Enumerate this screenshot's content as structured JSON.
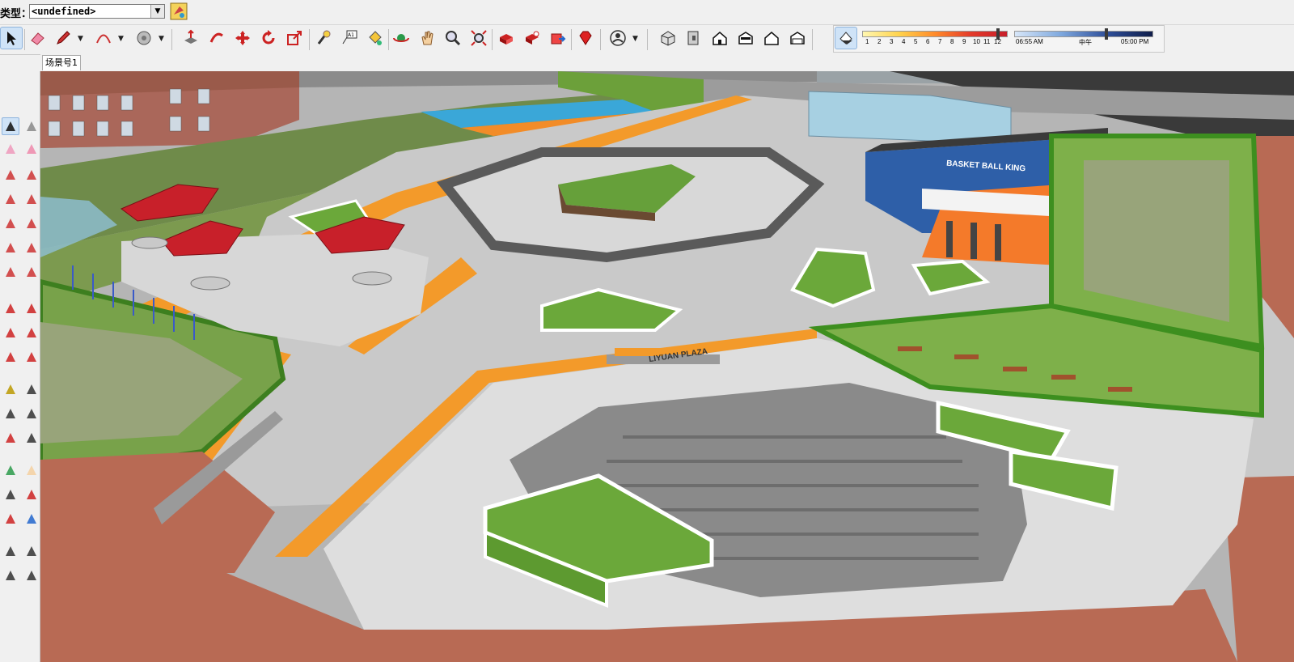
{
  "typebar": {
    "label": "类型：",
    "value": "<undefined>"
  },
  "shadow": {
    "month_ticks": [
      "1",
      "2",
      "3",
      "4",
      "5",
      "6",
      "7",
      "8",
      "9",
      "10",
      "11",
      "12"
    ],
    "time_start": "06:55 AM",
    "time_mid": "中午",
    "time_end": "05:00 PM"
  },
  "tabs": {
    "scene1": "场景号1"
  },
  "scene": {
    "plaza_sign": "LIYUAN PLAZA",
    "court_text": "BASKET BALL KING"
  },
  "toolbar": {
    "icons": [
      "select-icon",
      "eraser-icon",
      "pencil-icon",
      "arc-icon",
      "offset-icon",
      "push-pull-icon",
      "follow-me-icon",
      "move-icon",
      "rotate-icon",
      "scale-icon",
      "tape-measure-icon",
      "text-icon",
      "paint-bucket-icon",
      "orbit-icon",
      "pan-icon",
      "zoom-icon",
      "zoom-extents-icon",
      "warehouse-icon",
      "extension-warehouse-icon",
      "share-model-icon",
      "ruby-icon",
      "user-icon",
      "iso-view-icon",
      "top-view-icon",
      "front-view-icon",
      "right-view-icon",
      "back-view-icon",
      "left-view-icon",
      "shadow-toggle-icon"
    ]
  }
}
